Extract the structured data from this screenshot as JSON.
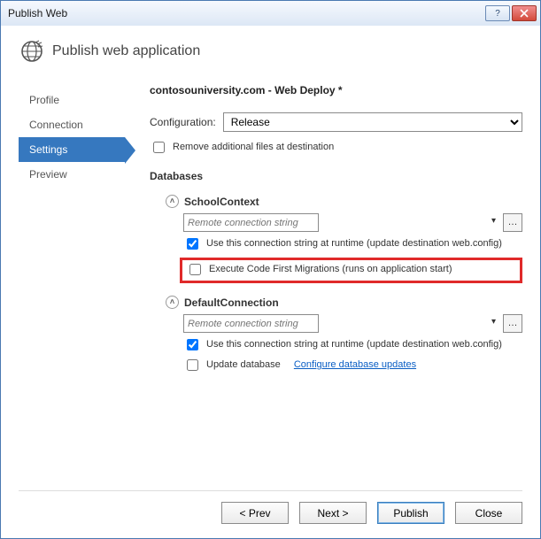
{
  "window": {
    "title": "Publish Web"
  },
  "header": {
    "title": "Publish web application"
  },
  "sidebar": {
    "items": [
      {
        "label": "Profile"
      },
      {
        "label": "Connection"
      },
      {
        "label": "Settings"
      },
      {
        "label": "Preview"
      }
    ]
  },
  "main": {
    "title": "contosouniversity.com - Web Deploy *",
    "config_label": "Configuration:",
    "config_value": "Release",
    "remove_files_label": "Remove additional files at destination",
    "databases_heading": "Databases",
    "db1": {
      "name": "SchoolContext",
      "placeholder": "Remote connection string",
      "use_conn_label": "Use this connection string at runtime (update destination web.config)",
      "migrations_label": "Execute Code First Migrations (runs on application start)"
    },
    "db2": {
      "name": "DefaultConnection",
      "placeholder": "Remote connection string",
      "use_conn_label": "Use this connection string at runtime (update destination web.config)",
      "update_db_label": "Update database",
      "configure_link": "Configure database updates"
    }
  },
  "footer": {
    "prev": "< Prev",
    "next": "Next >",
    "publish": "Publish",
    "close": "Close"
  }
}
